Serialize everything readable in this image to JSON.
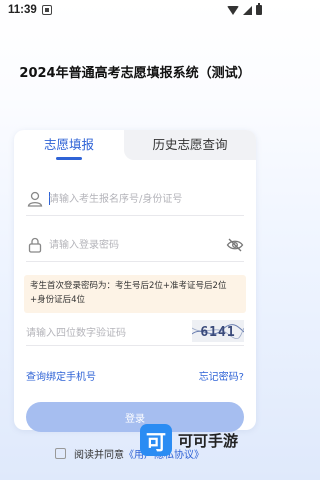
{
  "status_bar": {
    "time": "11:39"
  },
  "title": "2024年普通高考志愿填报系统（测试）",
  "tabs": [
    {
      "label": "志愿填报",
      "active": true
    },
    {
      "label": "历史志愿查询",
      "active": false
    }
  ],
  "form": {
    "user_placeholder": "请输入考生报名序号/身份证号",
    "password_placeholder": "请输入登录密码",
    "hint": "考生首次登录密码为：考生号后2位+准考证号后2位+身份证后4位",
    "captcha_placeholder": "请输入四位数字验证码",
    "captcha_text": "6141",
    "query_phone_link": "查询绑定手机号",
    "forgot_link": "忘记密码?",
    "login_label": "登录",
    "agree_text": "阅读并同意",
    "agree_link": "《用户隐私协议》"
  },
  "watermark": {
    "logo": "可",
    "text": "可可手游"
  },
  "colors": {
    "accent": "#2f63d6",
    "button": "#a6bef0",
    "hint_bg": "#fdf3e6"
  }
}
